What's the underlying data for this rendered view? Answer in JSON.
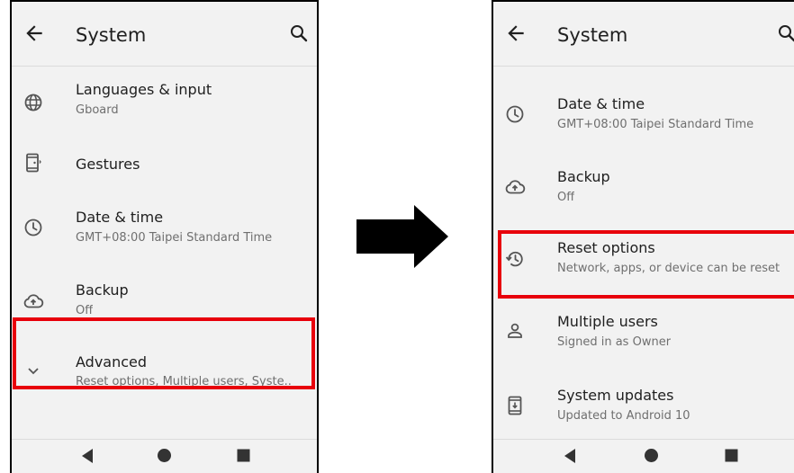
{
  "left_screen": {
    "title": "System",
    "items": [
      {
        "title": "Languages & input",
        "subtitle": "Gboard",
        "icon": "globe-icon"
      },
      {
        "title": "Gestures",
        "subtitle": "",
        "icon": "gestures-phone-icon"
      },
      {
        "title": "Date & time",
        "subtitle": "GMT+08:00 Taipei Standard Time",
        "icon": "clock-icon"
      },
      {
        "title": "Backup",
        "subtitle": "Off",
        "icon": "cloud-upload-icon"
      },
      {
        "title": "Advanced",
        "subtitle": "Reset options, Multiple users, Syste..",
        "icon": "chevron-down-icon"
      }
    ]
  },
  "right_screen": {
    "title": "System",
    "items": [
      {
        "title": "Date & time",
        "subtitle": "GMT+08:00 Taipei Standard Time",
        "icon": "clock-icon"
      },
      {
        "title": "Backup",
        "subtitle": "Off",
        "icon": "cloud-upload-icon"
      },
      {
        "title": "Reset options",
        "subtitle": "Network, apps, or device can be reset",
        "icon": "restore-icon"
      },
      {
        "title": "Multiple users",
        "subtitle": "Signed in as Owner",
        "icon": "person-icon"
      },
      {
        "title": "System updates",
        "subtitle": "Updated to Android 10",
        "icon": "system-update-icon"
      }
    ]
  },
  "colors": {
    "highlight": "#e8000b",
    "screen_background": "#f2f2f2",
    "arrow": "#000000"
  }
}
